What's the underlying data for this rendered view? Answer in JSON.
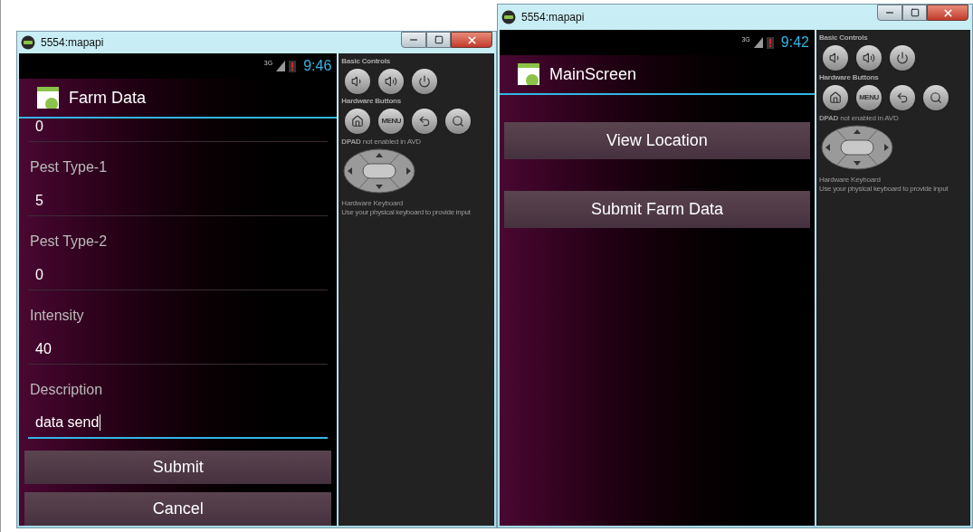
{
  "windows": [
    {
      "title": "5554:mapapi",
      "network": "3G",
      "status_time": "9:46",
      "app_title": "Farm Data",
      "screen": {
        "kind": "form",
        "fields": [
          {
            "value": "0",
            "focused": false
          },
          {
            "label": "Pest Type-1",
            "value": "5",
            "focused": false
          },
          {
            "label": "Pest Type-2",
            "value": "0",
            "focused": false
          },
          {
            "label": "Intensity",
            "value": "40",
            "focused": false
          },
          {
            "label": "Description",
            "value": "data send",
            "focused": true
          }
        ],
        "buttons": [
          "Submit",
          "Cancel"
        ]
      },
      "controls": {
        "basic_label": "Basic Controls",
        "hardware_label": "Hardware Buttons",
        "menu_key": "MENU",
        "dpad_note": "**DPAD** not enabled in AVD",
        "keyboard_title": "Hardware Keyboard",
        "keyboard_note": "Use your physical keyboard to provide input"
      }
    },
    {
      "title": "5554:mapapi",
      "network": "3G",
      "status_time": "9:42",
      "app_title": "MainScreen",
      "screen": {
        "kind": "menu",
        "buttons": [
          "View Location",
          "Submit Farm Data"
        ]
      },
      "controls": {
        "basic_label": "Basic Controls",
        "hardware_label": "Hardware Buttons",
        "menu_key": "MENU",
        "dpad_note": "**DPAD** not enabled in AVD",
        "keyboard_title": "Hardware Keyboard",
        "keyboard_note": "Use your physical keyboard to provide input"
      }
    }
  ]
}
